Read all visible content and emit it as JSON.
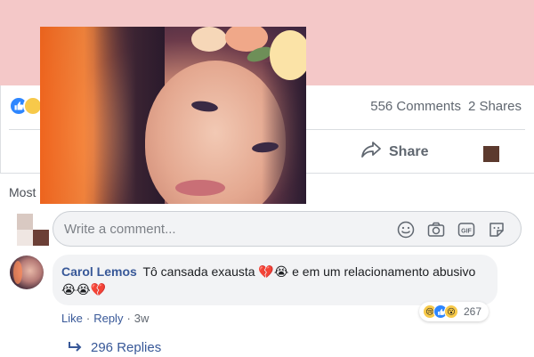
{
  "post": {
    "comments_count": "556 Comments",
    "shares_count": "2 Shares",
    "share_label": "Share",
    "sort_label": "Most"
  },
  "composer": {
    "placeholder": "Write a comment...",
    "icons": [
      "emoji-icon",
      "camera-icon",
      "gif-icon",
      "sticker-icon"
    ]
  },
  "comment": {
    "author": "Carol Lemos",
    "text": "Tô cansada exausta 💔😭 e em um relacionamento abusivo 😭😭💔",
    "like_label": "Like",
    "reply_label": "Reply",
    "separator": "·",
    "time": "3w",
    "reaction_count": "267",
    "reactions": [
      "sad",
      "like",
      "wow"
    ],
    "replies_label": "296 Replies"
  },
  "colors": {
    "link": "#385898",
    "banner": "#f4c8c8",
    "like_blue": "#2d86ff"
  }
}
